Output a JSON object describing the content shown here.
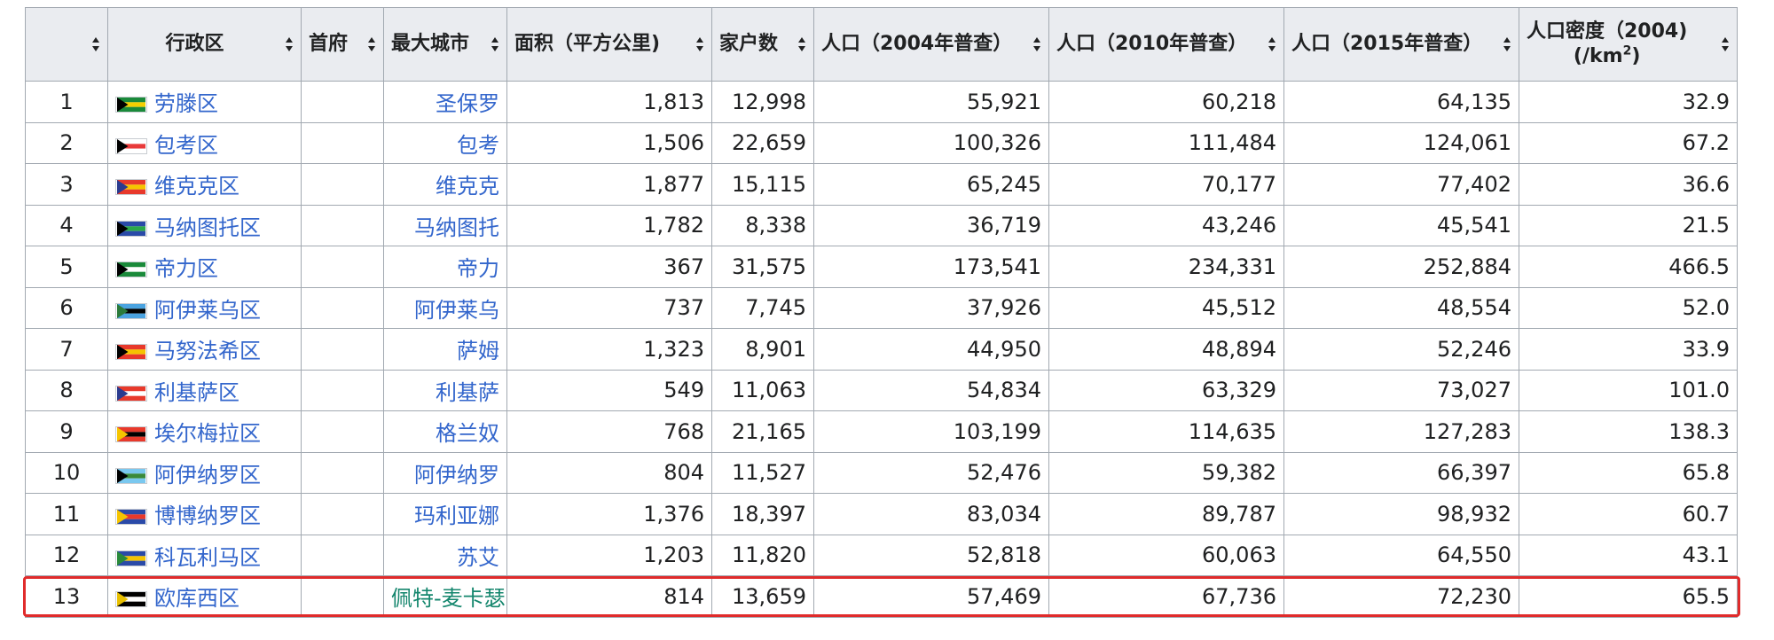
{
  "headers": [
    {
      "label": "",
      "sortable": true
    },
    {
      "label": "行政区",
      "sortable": true
    },
    {
      "label": "首府",
      "sortable": true
    },
    {
      "label": "最大城市",
      "sortable": true
    },
    {
      "label": "面积（平方公里)",
      "sortable": true
    },
    {
      "label": "家户数",
      "sortable": true
    },
    {
      "label": "人口（2004年普查）",
      "sortable": true
    },
    {
      "label": "人口（2010年普查）",
      "sortable": true
    },
    {
      "label": "人口（2015年普查）",
      "sortable": true
    },
    {
      "label_line1": "人口密度（2004)",
      "label_line2_pre": "(/km",
      "label_line2_sup": "2",
      "label_line2_post": ")",
      "sortable": true
    }
  ],
  "rows": [
    {
      "n": "1",
      "district": "劳滕区",
      "city": "圣保罗",
      "area": "1,813",
      "households": "12,998",
      "pop2004": "55,921",
      "pop2010": "60,218",
      "pop2015": "64,135",
      "density": "32.9",
      "flag": [
        "#1a8a3a",
        "#f4d000",
        "#000000"
      ]
    },
    {
      "n": "2",
      "district": "包考区",
      "city": "包考",
      "area": "1,506",
      "households": "22,659",
      "pop2004": "100,326",
      "pop2010": "111,484",
      "pop2015": "124,061",
      "density": "67.2",
      "flag": [
        "#ffffff",
        "#e83a3a",
        "#000000"
      ]
    },
    {
      "n": "3",
      "district": "维克克区",
      "city": "维克克",
      "area": "1,877",
      "households": "15,115",
      "pop2004": "65,245",
      "pop2010": "70,177",
      "pop2015": "77,402",
      "density": "36.6",
      "flag": [
        "#e8392b",
        "#f5c400",
        "#2a3b8f"
      ]
    },
    {
      "n": "4",
      "district": "马纳图托区",
      "city": "马纳图托",
      "area": "1,782",
      "households": "8,338",
      "pop2004": "36,719",
      "pop2010": "43,246",
      "pop2015": "45,541",
      "density": "21.5",
      "flag": [
        "#2a4aa8",
        "#2aa84a",
        "#000000"
      ]
    },
    {
      "n": "5",
      "district": "帝力区",
      "city": "帝力",
      "area": "367",
      "households": "31,575",
      "pop2004": "173,541",
      "pop2010": "234,331",
      "pop2015": "252,884",
      "density": "466.5",
      "flag": [
        "#1a8a3a",
        "#ffffff",
        "#000000"
      ]
    },
    {
      "n": "6",
      "district": "阿伊莱乌区",
      "city": "阿伊莱乌",
      "area": "737",
      "households": "7,745",
      "pop2004": "37,926",
      "pop2010": "45,512",
      "pop2015": "48,554",
      "density": "52.0",
      "flag": [
        "#4aa3e0",
        "#000000",
        "#2a7a3a"
      ]
    },
    {
      "n": "7",
      "district": "马努法希区",
      "city": "萨姆",
      "area": "1,323",
      "households": "8,901",
      "pop2004": "44,950",
      "pop2010": "48,894",
      "pop2015": "52,246",
      "density": "33.9",
      "flag": [
        "#e8392b",
        "#f5c400",
        "#000000"
      ]
    },
    {
      "n": "8",
      "district": "利基萨区",
      "city": "利基萨",
      "area": "549",
      "households": "11,063",
      "pop2004": "54,834",
      "pop2010": "63,329",
      "pop2015": "73,027",
      "density": "101.0",
      "flag": [
        "#e8392b",
        "#ffffff",
        "#2a3b8f"
      ]
    },
    {
      "n": "9",
      "district": "埃尔梅拉区",
      "city": "格兰奴",
      "area": "768",
      "households": "21,165",
      "pop2004": "103,199",
      "pop2010": "114,635",
      "pop2015": "127,283",
      "density": "138.3",
      "flag": [
        "#e8392b",
        "#000000",
        "#f5c400"
      ]
    },
    {
      "n": "10",
      "district": "阿伊纳罗区",
      "city": "阿伊纳罗",
      "area": "804",
      "households": "11,527",
      "pop2004": "52,476",
      "pop2010": "59,382",
      "pop2015": "66,397",
      "density": "65.8",
      "flag": [
        "#7ac8ef",
        "#3a8a3a",
        "#000000"
      ]
    },
    {
      "n": "11",
      "district": "博博纳罗区",
      "city": "玛利亚娜",
      "area": "1,376",
      "households": "18,397",
      "pop2004": "83,034",
      "pop2010": "89,787",
      "pop2015": "98,932",
      "density": "60.7",
      "flag": [
        "#2a4aa8",
        "#e8392b",
        "#f5c400"
      ]
    },
    {
      "n": "12",
      "district": "科瓦利马区",
      "city": "苏艾",
      "area": "1,203",
      "households": "11,820",
      "pop2004": "52,818",
      "pop2010": "60,063",
      "pop2015": "64,550",
      "density": "43.1",
      "flag": [
        "#2a4aa8",
        "#f5c400",
        "#2a8a3a"
      ]
    },
    {
      "n": "13",
      "district": "欧库西区",
      "city": "佩特-麦卡瑟",
      "area": "814",
      "households": "13,659",
      "pop2004": "57,469",
      "pop2010": "67,736",
      "pop2015": "72,230",
      "density": "65.5",
      "flag": [
        "#000000",
        "#ffffff",
        "#e8c000"
      ],
      "city_visited": true,
      "highlighted": true
    }
  ],
  "colors": {
    "link": "#3366cc",
    "visited_link": "#14866d",
    "header_bg": "#eaecf0",
    "border": "#a2a9b1",
    "highlight": "#e02b2b"
  }
}
